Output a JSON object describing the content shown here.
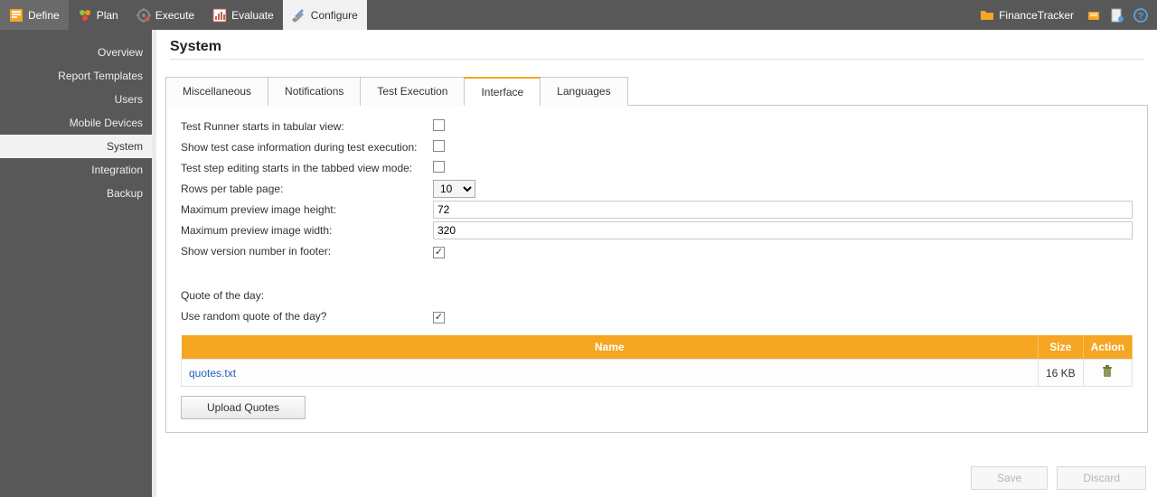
{
  "topnav": {
    "items": [
      {
        "label": "Define"
      },
      {
        "label": "Plan"
      },
      {
        "label": "Execute"
      },
      {
        "label": "Evaluate"
      },
      {
        "label": "Configure",
        "selected": true
      }
    ],
    "project_label": "FinanceTracker"
  },
  "sidebar": {
    "items": [
      {
        "label": "Overview"
      },
      {
        "label": "Report Templates"
      },
      {
        "label": "Users"
      },
      {
        "label": "Mobile Devices"
      },
      {
        "label": "System",
        "selected": true
      },
      {
        "label": "Integration"
      },
      {
        "label": "Backup"
      }
    ]
  },
  "page_title": "System",
  "tabs": [
    {
      "label": "Miscellaneous"
    },
    {
      "label": "Notifications"
    },
    {
      "label": "Test Execution"
    },
    {
      "label": "Interface",
      "selected": true
    },
    {
      "label": "Languages"
    }
  ],
  "form": {
    "tabular_view_label": "Test Runner starts in tabular view:",
    "tabular_view_checked": false,
    "show_testcase_info_label": "Show test case information during test execution:",
    "show_testcase_info_checked": false,
    "tabbed_view_label": "Test step editing starts in the tabbed view mode:",
    "tabbed_view_checked": false,
    "rows_label": "Rows per table page:",
    "rows_value": "10",
    "max_height_label": "Maximum preview image height:",
    "max_height_value": "72",
    "max_width_label": "Maximum preview image width:",
    "max_width_value": "320",
    "show_version_label": "Show version number in footer:",
    "show_version_checked": true,
    "quote_label": "Quote of the day:",
    "random_quote_label": "Use random quote of the day?",
    "random_quote_checked": true
  },
  "table": {
    "headers": {
      "name": "Name",
      "size": "Size",
      "action": "Action"
    },
    "rows": [
      {
        "name": "quotes.txt",
        "size": "16 KB"
      }
    ],
    "upload_label": "Upload Quotes"
  },
  "footer": {
    "save": "Save",
    "discard": "Discard"
  }
}
